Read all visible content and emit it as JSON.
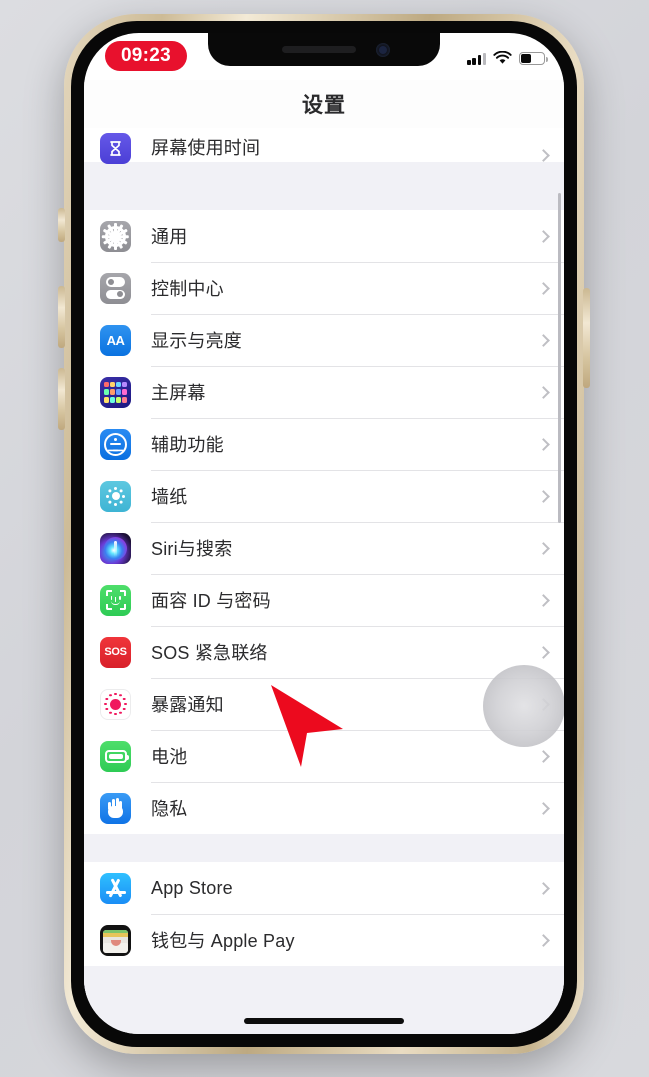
{
  "status_bar": {
    "time": "09:23",
    "time_pill_color": "#e8112d",
    "signal_icon": "cellular-signal-icon",
    "wifi_icon": "wifi-icon",
    "battery_icon": "battery-icon",
    "battery_level_percent": 40
  },
  "nav": {
    "title": "设置"
  },
  "groups": [
    {
      "id": "group-screentime",
      "clipped_top": true,
      "rows": [
        {
          "label": "屏幕使用时间",
          "icon": "screen-time-icon",
          "icon_class": "ic-screentime",
          "name": "screen-time"
        }
      ]
    },
    {
      "id": "group-system",
      "rows": [
        {
          "label": "通用",
          "icon": "gear-icon",
          "icon_class": "ic-general",
          "name": "general"
        },
        {
          "label": "控制中心",
          "icon": "control-center-icon",
          "icon_class": "ic-control",
          "name": "control-center"
        },
        {
          "label": "显示与亮度",
          "icon": "display-aa-icon",
          "icon_class": "ic-display",
          "name": "display-brightness"
        },
        {
          "label": "主屏幕",
          "icon": "home-screen-icon",
          "icon_class": "ic-home",
          "name": "home-screen"
        },
        {
          "label": "辅助功能",
          "icon": "accessibility-icon",
          "icon_class": "ic-access",
          "name": "accessibility"
        },
        {
          "label": "墙纸",
          "icon": "wallpaper-icon",
          "icon_class": "ic-wallpaper",
          "name": "wallpaper"
        },
        {
          "label": "Siri与搜索",
          "icon": "siri-icon",
          "icon_class": "ic-siri",
          "name": "siri-search"
        },
        {
          "label": "面容 ID 与密码",
          "icon": "face-id-icon",
          "icon_class": "ic-faceid",
          "name": "face-id-passcode"
        },
        {
          "label": "SOS 紧急联络",
          "icon": "sos-icon",
          "icon_class": "ic-sos",
          "name": "emergency-sos"
        },
        {
          "label": "暴露通知",
          "icon": "exposure-notification-icon",
          "icon_class": "ic-exposure",
          "name": "exposure-notifications"
        },
        {
          "label": "电池",
          "icon": "battery-icon",
          "icon_class": "ic-battery",
          "name": "battery"
        },
        {
          "label": "隐私",
          "icon": "privacy-hand-icon",
          "icon_class": "ic-privacy",
          "name": "privacy"
        }
      ]
    },
    {
      "id": "group-store",
      "rows": [
        {
          "label": "App Store",
          "icon": "app-store-icon",
          "icon_class": "ic-appstore",
          "name": "app-store"
        },
        {
          "label": "钱包与 Apple Pay",
          "icon": "wallet-icon",
          "icon_class": "ic-wallet",
          "name": "wallet-apple-pay"
        }
      ]
    }
  ],
  "overlays": {
    "cursor_icon": "red-arrow-cursor",
    "cursor_color": "#ec0a1e",
    "tap_indicator": "tap-highlight-circle"
  },
  "device": {
    "frame_color": "#d6c29a",
    "home_indicator": "home-indicator-bar",
    "buttons": [
      "mute-switch",
      "volume-up-button",
      "volume-down-button",
      "power-button"
    ]
  },
  "colors": {
    "page_background": "#d6d7db",
    "list_background": "#ffffff",
    "group_gap": "#f1f1f6",
    "separator": "#e3e3e6",
    "label_text": "#2b2b2d",
    "chevron": "#bfbfc4"
  }
}
